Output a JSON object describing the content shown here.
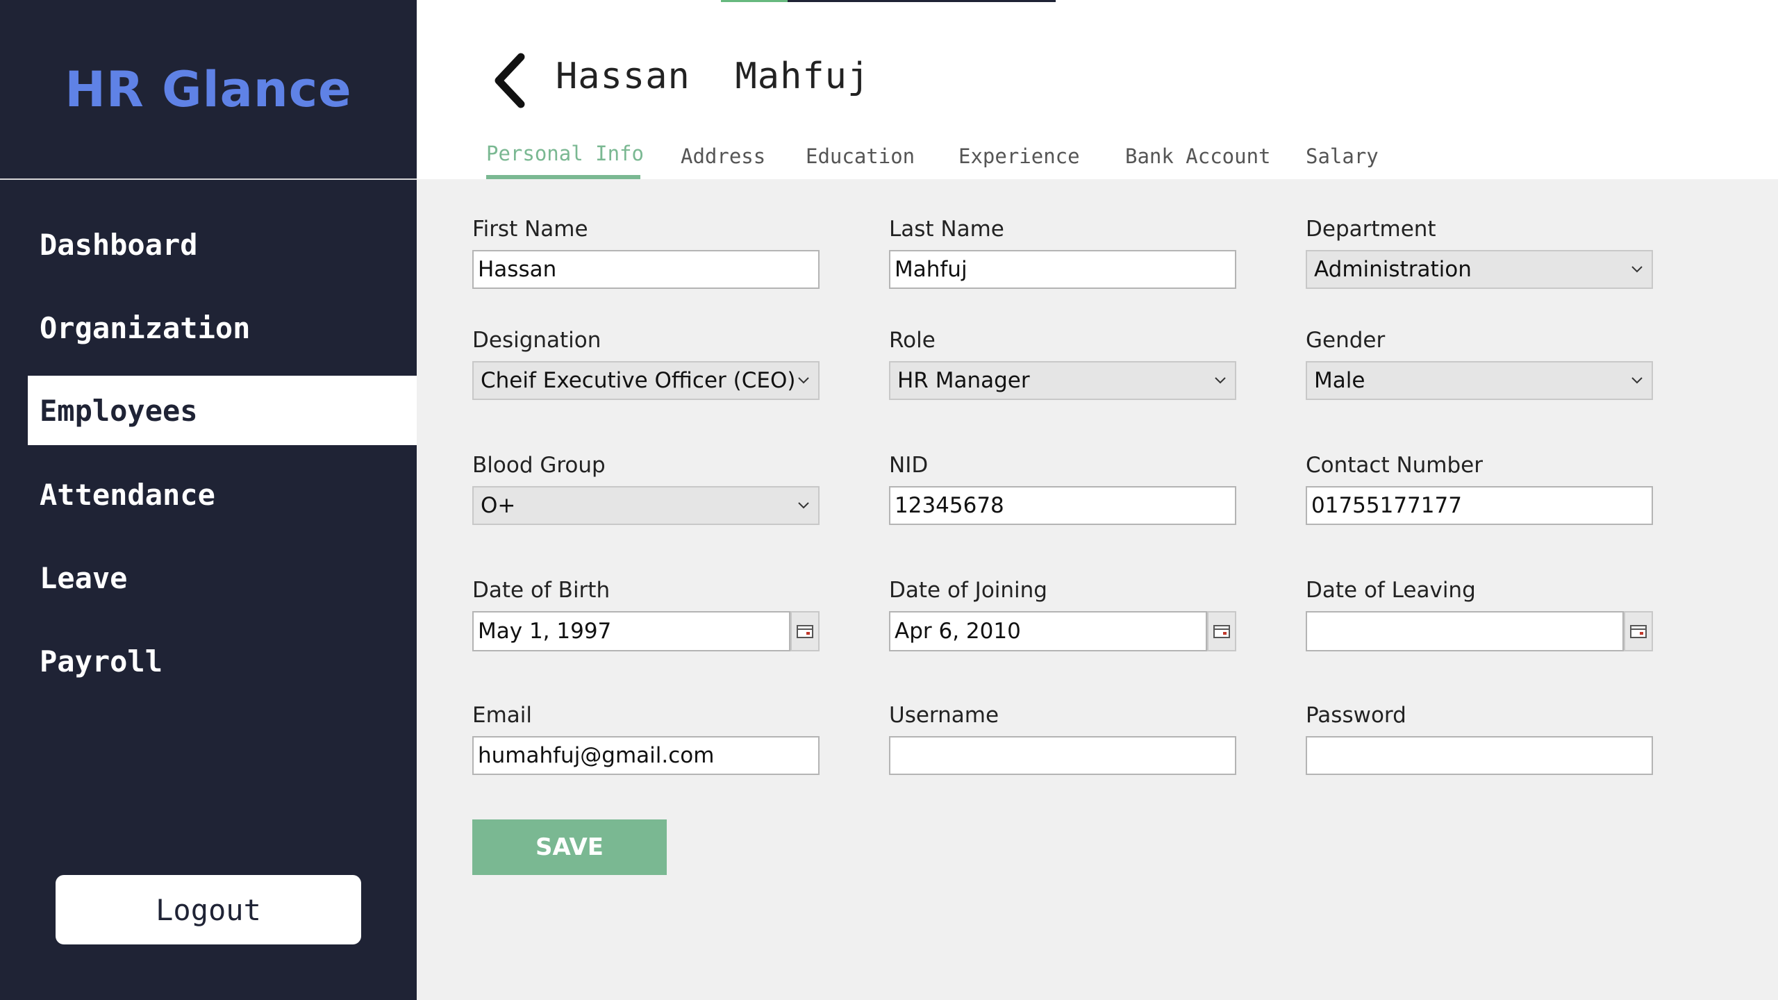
{
  "app": {
    "brand": "HR Glance"
  },
  "sidebar": {
    "items": [
      {
        "label": "Dashboard"
      },
      {
        "label": "Organization"
      },
      {
        "label": "Employees",
        "active": true
      },
      {
        "label": "Attendance"
      },
      {
        "label": "Leave"
      },
      {
        "label": "Payroll"
      }
    ],
    "logout_label": "Logout"
  },
  "header": {
    "title": "Hassan  Mahfuj",
    "back_icon": "chevron-left-icon",
    "tabs": [
      {
        "label": "Personal Info",
        "active": true
      },
      {
        "label": "Address"
      },
      {
        "label": "Education"
      },
      {
        "label": "Experience"
      },
      {
        "label": "Bank Account"
      },
      {
        "label": "Salary"
      }
    ]
  },
  "form": {
    "first_name": {
      "label": "First Name",
      "value": "Hassan"
    },
    "last_name": {
      "label": "Last Name",
      "value": "Mahfuj"
    },
    "department": {
      "label": "Department",
      "value": "Administration"
    },
    "designation": {
      "label": "Designation",
      "value": "Cheif Executive Officer (CEO)"
    },
    "role": {
      "label": "Role",
      "value": "HR Manager"
    },
    "gender": {
      "label": "Gender",
      "value": "Male"
    },
    "blood_group": {
      "label": "Blood Group",
      "value": "O+"
    },
    "nid": {
      "label": "NID",
      "value": "12345678"
    },
    "contact_number": {
      "label": "Contact Number",
      "value": "01755177177"
    },
    "date_of_birth": {
      "label": "Date of Birth",
      "value": "May 1, 1997"
    },
    "date_of_joining": {
      "label": "Date of Joining",
      "value": "Apr 6, 2010"
    },
    "date_of_leaving": {
      "label": "Date of Leaving",
      "value": ""
    },
    "email": {
      "label": "Email",
      "value": "humahfuj@gmail.com"
    },
    "username": {
      "label": "Username",
      "value": ""
    },
    "password": {
      "label": "Password",
      "value": ""
    },
    "save_label": "SAVE"
  },
  "colors": {
    "sidebar_bg": "#1f2335",
    "brand": "#5f82e6",
    "accent": "#7ab892",
    "content_bg": "#f0f0f0"
  }
}
